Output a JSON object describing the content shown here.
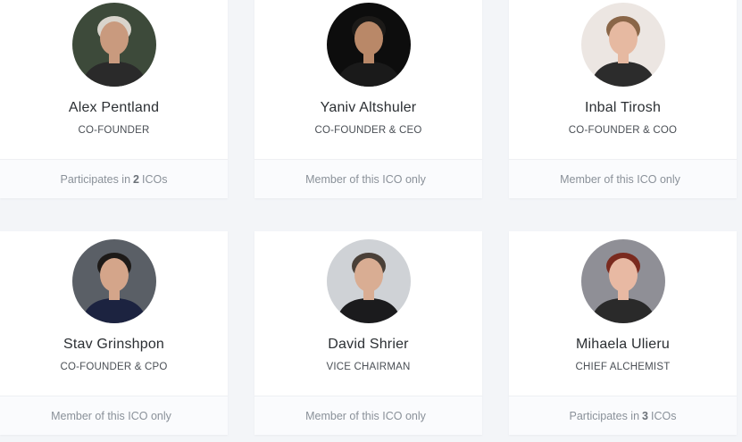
{
  "team": [
    {
      "name": "Alex Pentland",
      "role": "CO-FOUNDER",
      "footer_pre": "Participates in",
      "footer_count": "2",
      "footer_post": "ICOs",
      "avatar_bg": "#3d4a3a",
      "skin": "#c99a7e",
      "hair": "#d9d4cc",
      "shirt": "#2a2a2a"
    },
    {
      "name": "Yaniv Altshuler",
      "role": "CO-FOUNDER & CEO",
      "footer_pre": "Member of this ICO only",
      "footer_count": "",
      "footer_post": "",
      "avatar_bg": "#0d0d0d",
      "skin": "#b98868",
      "hair": "#1c1a18",
      "shirt": "#1a1a1a"
    },
    {
      "name": "Inbal Tirosh",
      "role": "CO-FOUNDER & COO",
      "footer_pre": "Member of this ICO only",
      "footer_count": "",
      "footer_post": "",
      "avatar_bg": "#ece6e2",
      "skin": "#e6b9a1",
      "hair": "#8a6648",
      "shirt": "#2c2c2c"
    },
    {
      "name": "Stav Grinshpon",
      "role": "CO-FOUNDER & CPO",
      "footer_pre": "Member of this ICO only",
      "footer_count": "",
      "footer_post": "",
      "avatar_bg": "#5a5f66",
      "skin": "#d4a58a",
      "hair": "#1d1a18",
      "shirt": "#1c2340"
    },
    {
      "name": "David Shrier",
      "role": "VICE CHAIRMAN",
      "footer_pre": "Member of this ICO only",
      "footer_count": "",
      "footer_post": "",
      "avatar_bg": "#cfd2d6",
      "skin": "#d9ad93",
      "hair": "#4a4038",
      "shirt": "#1b1b1d"
    },
    {
      "name": "Mihaela Ulieru",
      "role": "CHIEF ALCHEMIST",
      "footer_pre": "Participates in",
      "footer_count": "3",
      "footer_post": "ICOs",
      "avatar_bg": "#8f8f96",
      "skin": "#e8b9a3",
      "hair": "#7a2a1e",
      "shirt": "#2a2a2a"
    }
  ]
}
